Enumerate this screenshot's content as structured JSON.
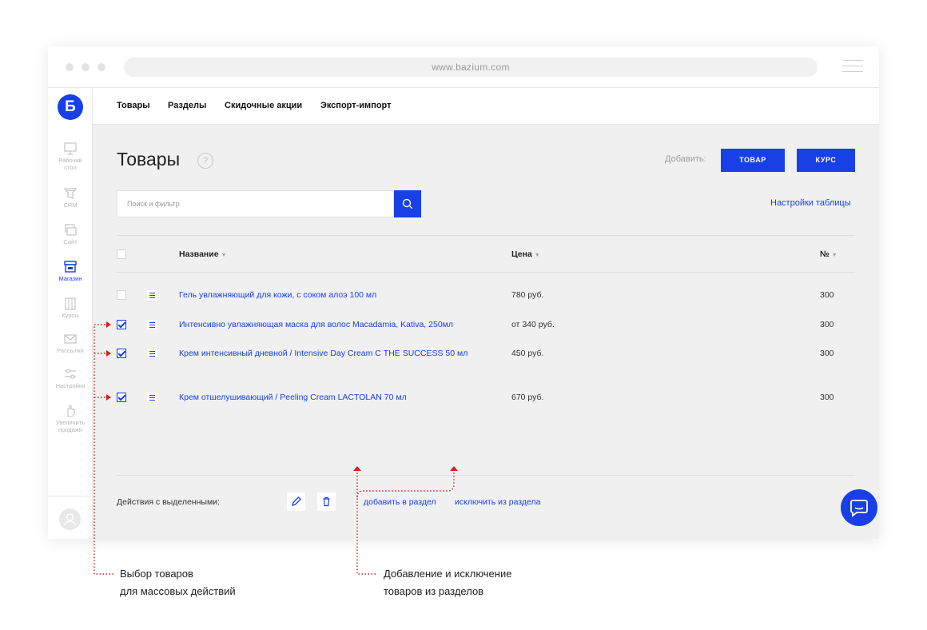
{
  "browser": {
    "url": "www.bazium.com"
  },
  "sidebar": {
    "logo": "Б",
    "items": [
      {
        "label": "Рабочий стол",
        "icon": "monitor-icon"
      },
      {
        "label": "CRM",
        "icon": "funnel-icon"
      },
      {
        "label": "Сайт",
        "icon": "layers-icon"
      },
      {
        "label": "Магазин",
        "icon": "store-icon",
        "active": true
      },
      {
        "label": "Курсы",
        "icon": "book-icon"
      },
      {
        "label": "Рассылки",
        "icon": "envelope-icon"
      },
      {
        "label": "Настройки",
        "icon": "sliders-icon"
      },
      {
        "label": "Увеличить продажи",
        "icon": "hand-icon"
      }
    ]
  },
  "topnav": {
    "items": [
      "Товары",
      "Разделы",
      "Скидочные акции",
      "Экспорт-импорт"
    ]
  },
  "page": {
    "title": "Товары",
    "help": "?",
    "add_label": "Добавить:",
    "btn_product": "ТОВАР",
    "btn_course": "КУРС",
    "search_placeholder": "Поиск и фильтр",
    "table_settings": "Настройки таблицы"
  },
  "table": {
    "headers": {
      "name": "Название",
      "price": "Цена",
      "num": "№",
      "sort_glyph": "▼"
    },
    "rows": [
      {
        "name": "Гель увлажняющий для кожи, с соком алоэ 100 мл",
        "price": "780 руб.",
        "num": "300",
        "checked": false
      },
      {
        "name": "Интенсивно увлажняющая маска для волос Macadamia, Kativa, 250мл",
        "price": "от 340 руб.",
        "num": "300",
        "checked": true
      },
      {
        "name": "Крем интенсивный дневной / Intensive Day Cream С THE SUCCESS 50 мл",
        "price": "450 руб.",
        "num": "300",
        "checked": true
      },
      {
        "name": "Крем отшелушивающий / Peeling Cream LACTOLAN 70 мл",
        "price": "670 руб.",
        "num": "300",
        "checked": true
      }
    ]
  },
  "bulk": {
    "label": "Действия с выделенными:",
    "add_to_section": "добавить в раздел",
    "remove_from_section": "исключить из раздела"
  },
  "annotations": {
    "left_line1": "Выбор товаров",
    "left_line2": "для массовых действий",
    "right_line1": "Добавление и исключение",
    "right_line2": "товаров из разделов"
  },
  "colors": {
    "accent": "#1840e6",
    "annotation": "#d81b1b",
    "main_bg": "#f0f0f0"
  }
}
